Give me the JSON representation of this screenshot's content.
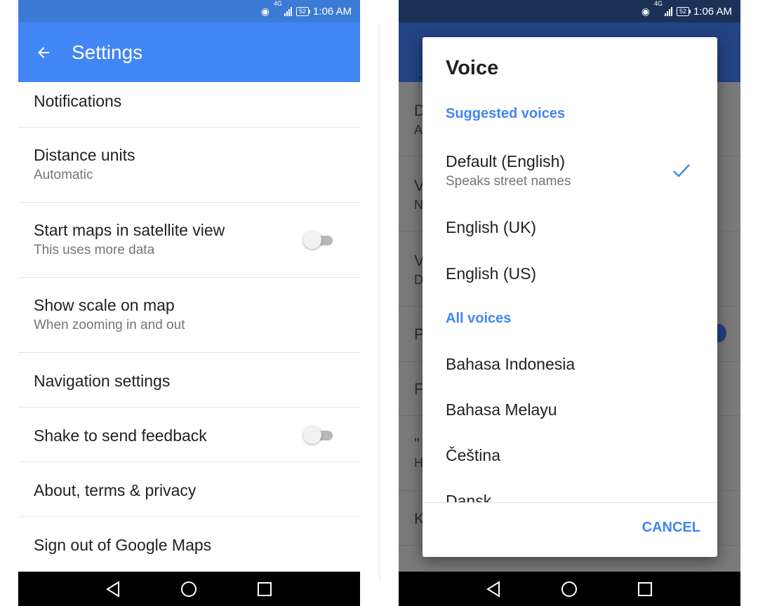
{
  "status_bar": {
    "time": "1:06 AM",
    "battery": "52",
    "network": "4G"
  },
  "settings": {
    "title": "Settings",
    "items": [
      {
        "title": "Notifications",
        "subtitle": ""
      },
      {
        "title": "Distance units",
        "subtitle": "Automatic"
      },
      {
        "title": "Start maps in satellite view",
        "subtitle": "This uses more data",
        "toggle": false
      },
      {
        "title": "Show scale on map",
        "subtitle": "When zooming in and out"
      },
      {
        "title": "Navigation settings",
        "subtitle": ""
      },
      {
        "title": "Shake to send feedback",
        "subtitle": "",
        "toggle": false
      },
      {
        "title": "About, terms & privacy",
        "subtitle": ""
      },
      {
        "title": "Sign out of Google Maps",
        "subtitle": ""
      }
    ]
  },
  "backdrop_letters": [
    "D",
    "A",
    "V",
    "N",
    "V",
    "D",
    "P",
    "F",
    "\"",
    "H",
    "K"
  ],
  "voice_dialog": {
    "title": "Voice",
    "suggested_header": "Suggested voices",
    "suggested": [
      {
        "label": "Default (English)",
        "subtitle": "Speaks street names",
        "selected": true
      },
      {
        "label": "English (UK)"
      },
      {
        "label": "English (US)"
      }
    ],
    "all_header": "All voices",
    "all": [
      {
        "label": "Bahasa Indonesia"
      },
      {
        "label": "Bahasa Melayu"
      },
      {
        "label": "Čeština"
      },
      {
        "label": "Dansk"
      }
    ],
    "cancel_label": "CANCEL"
  },
  "colors": {
    "accent": "#4285f4",
    "status_bar_left": "#3b7bd6",
    "status_bar_right": "#1b3158",
    "scrim": "#7a7a7a"
  },
  "icons": {
    "back": "arrow-back-icon",
    "nav_back": "triangle-back-icon",
    "nav_home": "circle-home-icon",
    "nav_recent": "square-recents-icon",
    "selected": "checkmark-icon"
  }
}
